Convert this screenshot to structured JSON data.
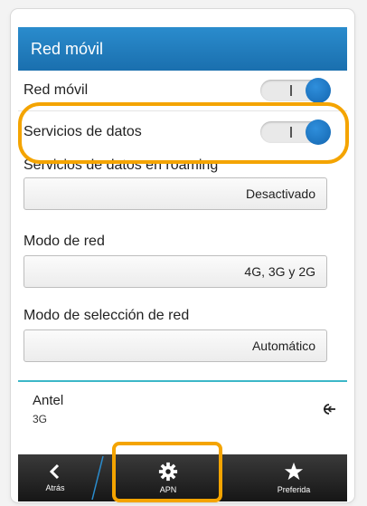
{
  "header": {
    "title": "Red móvil"
  },
  "toggles": [
    {
      "label": "Red móvil",
      "state": "I"
    },
    {
      "label": "Servicios de datos",
      "state": "I"
    }
  ],
  "dropdowns": [
    {
      "label": "Servicios de datos en roaming",
      "value": "Desactivado"
    },
    {
      "label": "Modo de red",
      "value": "4G, 3G y 2G"
    },
    {
      "label": "Modo de selección de red",
      "value": "Automático"
    }
  ],
  "apn": {
    "name": "Antel",
    "type": "3G",
    "icon": "signal-icon"
  },
  "toolbar": {
    "back_label": "Atrás",
    "apn_label": "APN",
    "preferred_label": "Preferida"
  },
  "colors": {
    "header": "#1f7ec3",
    "accent": "#1466b0",
    "highlight": "#f4a400",
    "divider": "#3cb7c8"
  }
}
